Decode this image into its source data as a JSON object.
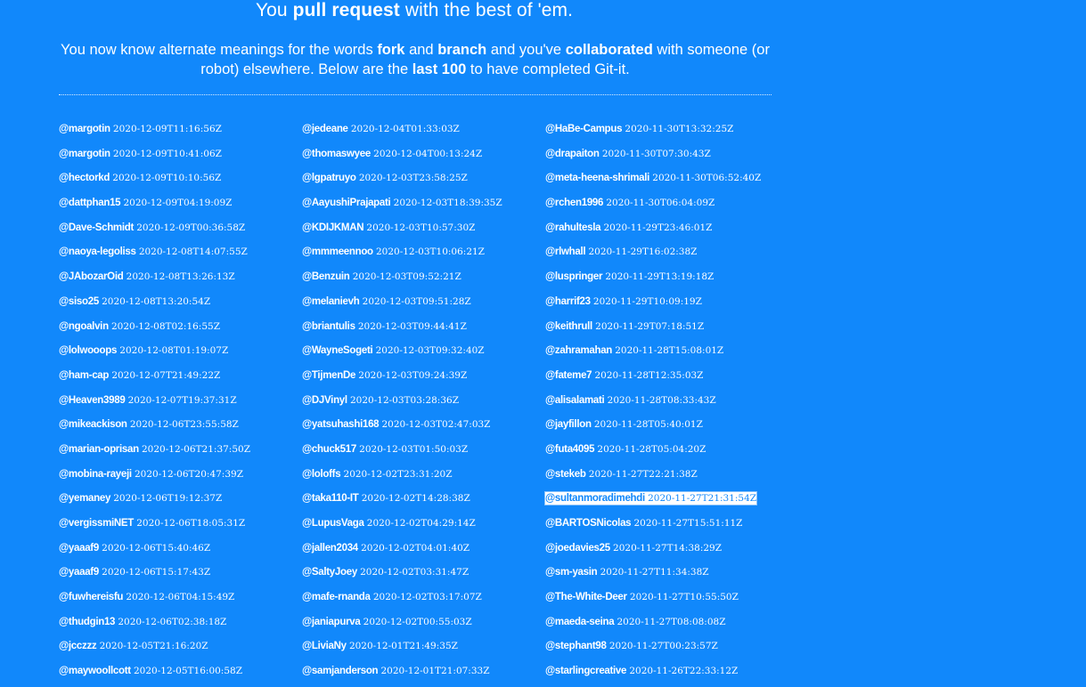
{
  "heading": {
    "pre": "You",
    "strong": "pull request",
    "post": "with the best of 'em."
  },
  "intro": {
    "t1": "You now know alternate meanings for the words",
    "fork": "fork",
    "and": "and",
    "branch": "branch",
    "t2": "and you've",
    "collaborated": "collaborated",
    "t3": "with someone (or robot) elsewhere. Below are the",
    "last100": "last 100",
    "t4": "to have completed Git-it."
  },
  "colors": {
    "background": "#1188fb",
    "text": "#ffffff"
  },
  "highlighted_user": "@sultanmoradimehdi",
  "columns": [
    [
      {
        "user": "@margotin",
        "time": "2020-12-09T11:16:56Z"
      },
      {
        "user": "@margotin",
        "time": "2020-12-09T10:41:06Z"
      },
      {
        "user": "@hectorkd",
        "time": "2020-12-09T10:10:56Z"
      },
      {
        "user": "@dattphan15",
        "time": "2020-12-09T04:19:09Z"
      },
      {
        "user": "@Dave-Schmidt",
        "time": "2020-12-09T00:36:58Z"
      },
      {
        "user": "@naoya-legoliss",
        "time": "2020-12-08T14:07:55Z"
      },
      {
        "user": "@JAbozarOid",
        "time": "2020-12-08T13:26:13Z"
      },
      {
        "user": "@siso25",
        "time": "2020-12-08T13:20:54Z"
      },
      {
        "user": "@ngoalvin",
        "time": "2020-12-08T02:16:55Z"
      },
      {
        "user": "@lolwooops",
        "time": "2020-12-08T01:19:07Z"
      },
      {
        "user": "@ham-cap",
        "time": "2020-12-07T21:49:22Z"
      },
      {
        "user": "@Heaven3989",
        "time": "2020-12-07T19:37:31Z"
      },
      {
        "user": "@mikeackison",
        "time": "2020-12-06T23:55:58Z"
      },
      {
        "user": "@marian-oprisan",
        "time": "2020-12-06T21:37:50Z"
      },
      {
        "user": "@mobina-rayeji",
        "time": "2020-12-06T20:47:39Z"
      },
      {
        "user": "@yemaney",
        "time": "2020-12-06T19:12:37Z"
      },
      {
        "user": "@vergissmiNET",
        "time": "2020-12-06T18:05:31Z"
      },
      {
        "user": "@yaaaf9",
        "time": "2020-12-06T15:40:46Z"
      },
      {
        "user": "@yaaaf9",
        "time": "2020-12-06T15:17:43Z"
      },
      {
        "user": "@fuwhereisfu",
        "time": "2020-12-06T04:15:49Z"
      },
      {
        "user": "@thudgin13",
        "time": "2020-12-06T02:38:18Z"
      },
      {
        "user": "@jcczzz",
        "time": "2020-12-05T21:16:20Z"
      },
      {
        "user": "@maywoollcott",
        "time": "2020-12-05T16:00:58Z"
      }
    ],
    [
      {
        "user": "@jedeane",
        "time": "2020-12-04T01:33:03Z"
      },
      {
        "user": "@thomaswyee",
        "time": "2020-12-04T00:13:24Z"
      },
      {
        "user": "@lgpatruyo",
        "time": "2020-12-03T23:58:25Z"
      },
      {
        "user": "@AayushiPrajapati",
        "time": "2020-12-03T18:39:35Z"
      },
      {
        "user": "@KDIJKMAN",
        "time": "2020-12-03T10:57:30Z"
      },
      {
        "user": "@mmmeennoo",
        "time": "2020-12-03T10:06:21Z"
      },
      {
        "user": "@Benzuin",
        "time": "2020-12-03T09:52:21Z"
      },
      {
        "user": "@melanievh",
        "time": "2020-12-03T09:51:28Z"
      },
      {
        "user": "@briantulis",
        "time": "2020-12-03T09:44:41Z"
      },
      {
        "user": "@WayneSogeti",
        "time": "2020-12-03T09:32:40Z"
      },
      {
        "user": "@TijmenDe",
        "time": "2020-12-03T09:24:39Z"
      },
      {
        "user": "@DJVinyl",
        "time": "2020-12-03T03:28:36Z"
      },
      {
        "user": "@yatsuhashi168",
        "time": "2020-12-03T02:47:03Z"
      },
      {
        "user": "@chuck517",
        "time": "2020-12-03T01:50:03Z"
      },
      {
        "user": "@loloffs",
        "time": "2020-12-02T23:31:20Z"
      },
      {
        "user": "@taka110-IT",
        "time": "2020-12-02T14:28:38Z"
      },
      {
        "user": "@LupusVaga",
        "time": "2020-12-02T04:29:14Z"
      },
      {
        "user": "@jallen2034",
        "time": "2020-12-02T04:01:40Z"
      },
      {
        "user": "@SaltyJoey",
        "time": "2020-12-02T03:31:47Z"
      },
      {
        "user": "@mafe-rnanda",
        "time": "2020-12-02T03:17:07Z"
      },
      {
        "user": "@janiapurva",
        "time": "2020-12-02T00:55:03Z"
      },
      {
        "user": "@LiviaNy",
        "time": "2020-12-01T21:49:35Z"
      },
      {
        "user": "@samjanderson",
        "time": "2020-12-01T21:07:33Z"
      }
    ],
    [
      {
        "user": "@HaBe-Campus",
        "time": "2020-11-30T13:32:25Z"
      },
      {
        "user": "@drapaiton",
        "time": "2020-11-30T07:30:43Z"
      },
      {
        "user": "@meta-heena-shrimali",
        "time": "2020-11-30T06:52:40Z"
      },
      {
        "user": "@rchen1996",
        "time": "2020-11-30T06:04:09Z"
      },
      {
        "user": "@rahultesla",
        "time": "2020-11-29T23:46:01Z"
      },
      {
        "user": "@rlwhall",
        "time": "2020-11-29T16:02:38Z"
      },
      {
        "user": "@luspringer",
        "time": "2020-11-29T13:19:18Z"
      },
      {
        "user": "@harrif23",
        "time": "2020-11-29T10:09:19Z"
      },
      {
        "user": "@keithrull",
        "time": "2020-11-29T07:18:51Z"
      },
      {
        "user": "@zahramahan",
        "time": "2020-11-28T15:08:01Z"
      },
      {
        "user": "@fateme7",
        "time": "2020-11-28T12:35:03Z"
      },
      {
        "user": "@alisalamati",
        "time": "2020-11-28T08:33:43Z"
      },
      {
        "user": "@jayfillon",
        "time": "2020-11-28T05:40:01Z"
      },
      {
        "user": "@futa4095",
        "time": "2020-11-28T05:04:20Z"
      },
      {
        "user": "@stekeb",
        "time": "2020-11-27T22:21:38Z"
      },
      {
        "user": "@sultanmoradimehdi",
        "time": "2020-11-27T21:31:54Z"
      },
      {
        "user": "@BARTOSNicolas",
        "time": "2020-11-27T15:51:11Z"
      },
      {
        "user": "@joedavies25",
        "time": "2020-11-27T14:38:29Z"
      },
      {
        "user": "@sm-yasin",
        "time": "2020-11-27T11:34:38Z"
      },
      {
        "user": "@The-White-Deer",
        "time": "2020-11-27T10:55:50Z"
      },
      {
        "user": "@maeda-seina",
        "time": "2020-11-27T08:08:08Z"
      },
      {
        "user": "@stephant98",
        "time": "2020-11-27T00:23:57Z"
      },
      {
        "user": "@starlingcreative",
        "time": "2020-11-26T22:33:12Z"
      }
    ]
  ]
}
